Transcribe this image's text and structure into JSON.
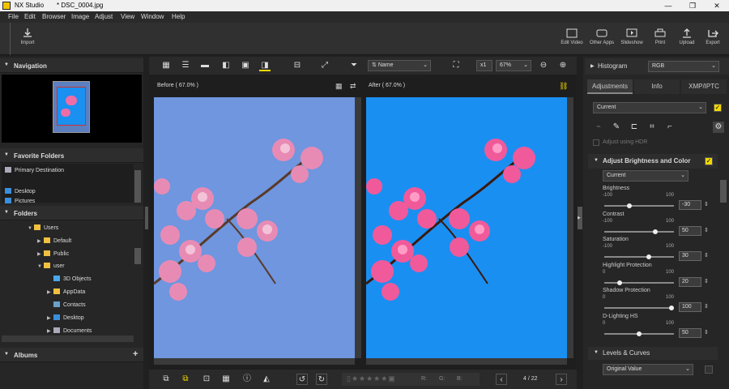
{
  "window": {
    "app": "NX Studio",
    "file": "* DSC_0004.jpg"
  },
  "menu": [
    "File",
    "Edit",
    "Browser",
    "Image",
    "Adjust",
    "View",
    "Window",
    "Help"
  ],
  "toolbar": {
    "import": "Import",
    "edit_video": "Edit Video",
    "other_apps": "Other Apps",
    "slideshow": "Slideshow",
    "print": "Print",
    "upload": "Upload",
    "export": "Export"
  },
  "left": {
    "navigation": "Navigation",
    "favorites": {
      "title": "Favorite Folders",
      "items": [
        "Primary Destination",
        "Desktop",
        "Pictures"
      ]
    },
    "folders": {
      "title": "Folders",
      "items": [
        "Users",
        "Default",
        "Public",
        "user",
        "3D Objects",
        "AppData",
        "Contacts",
        "Desktop",
        "Documents"
      ]
    },
    "albums": "Albums"
  },
  "viewer": {
    "sort": "Name",
    "zoom_mult": "x1",
    "zoom": "67%",
    "before": "Before ( 67.0% )",
    "after": "After ( 67.0% )"
  },
  "bottom": {
    "r": "R:",
    "g": "G:",
    "b": "B:",
    "page": "4 / 22"
  },
  "right": {
    "histogram": "Histogram",
    "hist_mode": "RGB",
    "tabs": [
      "Adjustments",
      "Info",
      "XMP/IPTC"
    ],
    "preset": "Current",
    "adjust_hdr": "Adjust using HDR",
    "section": "Adjust Brightness and Color",
    "section_preset": "Current",
    "sliders": [
      {
        "label": "Brightness",
        "min": "-100",
        "max": "100",
        "value": "-30",
        "pos": 0.35
      },
      {
        "label": "Contrast",
        "min": "-100",
        "max": "100",
        "value": "50",
        "pos": 0.75
      },
      {
        "label": "Saturation",
        "min": "-100",
        "max": "100",
        "value": "30",
        "pos": 0.65
      },
      {
        "label": "Highlight Protection",
        "min": "0",
        "max": "100",
        "value": "20",
        "pos": 0.2
      },
      {
        "label": "Shadow Protection",
        "min": "0",
        "max": "100",
        "value": "100",
        "pos": 1.0
      },
      {
        "label": "D-Lighting HS",
        "min": "0",
        "max": "100",
        "value": "50",
        "pos": 0.5
      }
    ],
    "levels": "Levels & Curves",
    "levels_preset": "Original Value"
  }
}
